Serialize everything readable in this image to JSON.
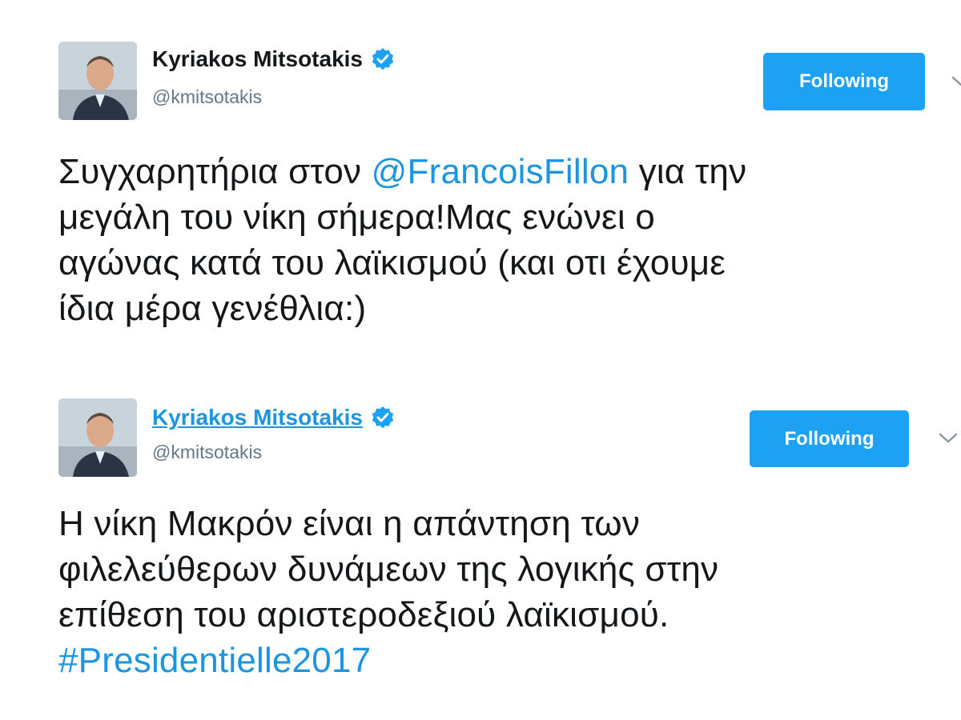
{
  "tweets": [
    {
      "author": {
        "name": "Kyriakos Mitsotakis",
        "handle": "@kmitsotakis",
        "verified": true
      },
      "follow_button": "Following",
      "text": {
        "line1_before": "Συγχαρητήρια στον ",
        "line1_mention": "@FrancoisFillon",
        "line1_after": " για την",
        "line2": "μεγάλη του νίκη σήμερα!Μας ενώνει ο",
        "line3": "αγώνας κατά του λαϊκισμού (και οτι έχουμε",
        "line4": "ίδια μέρα γενέθλια:)"
      }
    },
    {
      "author": {
        "name": "Kyriakos Mitsotakis",
        "handle": "@kmitsotakis",
        "verified": true
      },
      "follow_button": "Following",
      "text": {
        "line1": "Η νίκη Μακρόν είναι η απάντηση των",
        "line2": "φιλελεύθερων δυνάμεων της λογικής στην",
        "line3": "επίθεση του αριστεροδεξιού λαϊκισμού.",
        "hashtag": "#Presidentielle2017"
      }
    }
  ],
  "colors": {
    "link": "#1b95e0",
    "button": "#1da1f2",
    "text": "#14171a",
    "secondary": "#657786"
  },
  "icons": [
    "avatar-photo",
    "verified-badge-icon",
    "chevron-down-icon"
  ]
}
